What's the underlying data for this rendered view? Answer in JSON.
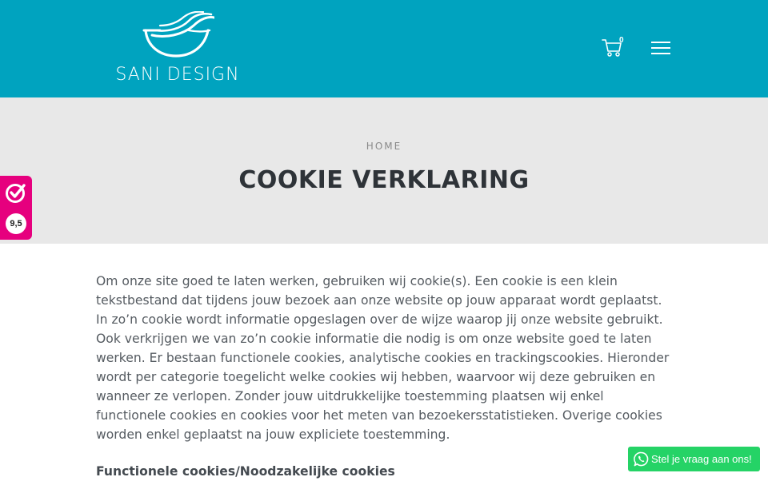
{
  "colors": {
    "brand": "#00a3bf",
    "hero_bg": "#e8e8e8",
    "rating_bg": "#e6007e",
    "whatsapp_bg": "#25d366"
  },
  "header": {
    "logo_text": "SANI DESIGN",
    "logo_icon": "bowl-logo-icon",
    "cart_icon": "shopping-cart-icon",
    "cart_count": "0",
    "menu_icon": "hamburger-menu-icon"
  },
  "hero": {
    "breadcrumb": "HOME",
    "title": "COOKIE VERKLARING"
  },
  "rating_widget": {
    "icon": "kiyoh-checkmark-icon",
    "score": "9,5"
  },
  "content": {
    "paragraph": "Om onze site goed te laten werken, gebruiken wij cookie(s). Een cookie is een klein tekstbestand dat tijdens jouw bezoek aan onze website op jouw apparaat wordt geplaatst. In zo’n cookie wordt informatie opgeslagen over de wijze waarop jij onze website gebruikt. Ook verkrijgen we van zo’n cookie informatie die nodig is om onze website goed te laten werken. Er bestaan functionele cookies, analytische cookies en trackingscookies. Hieronder wordt per categorie toegelicht welke cookies wij hebben, waarvoor wij deze gebruiken en wanneer ze verlopen. Zonder jouw uitdrukkelijke toestemming plaatsen wij enkel functionele cookies en cookies voor het meten van bezoekersstatistieken. Overige cookies worden enkel geplaatst na jouw expliciete toestemming.",
    "section_heading": "Functionele cookies/Noodzakelijke cookies"
  },
  "whatsapp": {
    "icon": "whatsapp-icon",
    "label": "Stel je vraag aan ons!"
  }
}
